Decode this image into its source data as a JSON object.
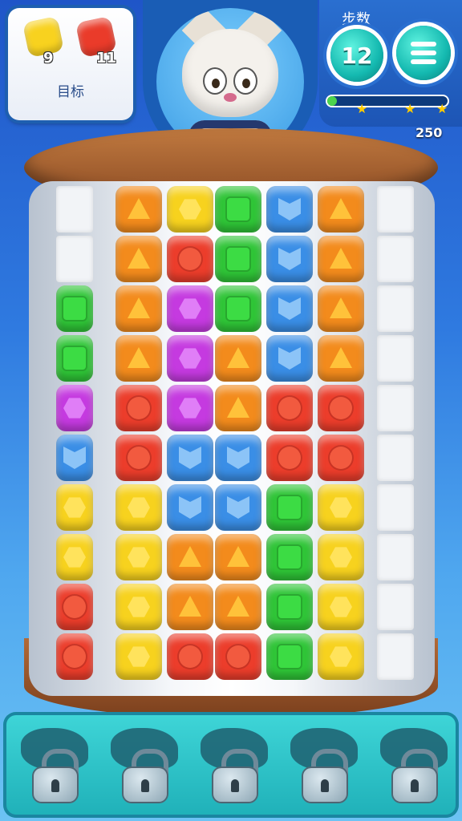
{
  "hud": {
    "goal": {
      "label": "目标",
      "items": [
        {
          "icon": "yellow-hexagon-cube-icon",
          "count": "9",
          "color": "#f8d21f"
        },
        {
          "icon": "red-circle-cube-icon",
          "count": "11",
          "color": "#ea3b2a"
        }
      ]
    },
    "moves_label": "步数",
    "moves_value": "12",
    "menu_icon": "menu-icon",
    "progress_fraction": 0.08,
    "stars": [
      "★",
      "★",
      "★"
    ],
    "score": "250"
  },
  "mascot": {
    "icon": "tiger-mascot-icon"
  },
  "colors": {
    "orange": "#f38b1c",
    "yellow": "#f7d21e",
    "green": "#2fc537",
    "blue": "#3a8ee6",
    "magenta": "#c53ae0",
    "red": "#ec3d2b",
    "white": "#f2f4f7"
  },
  "board": {
    "rows": [
      [
        "white",
        "orange",
        "yellow",
        "green",
        "blue",
        "orange",
        "white"
      ],
      [
        "white",
        "orange",
        "red",
        "green",
        "blue",
        "orange",
        "white"
      ],
      [
        "green",
        "orange",
        "magenta",
        "green",
        "blue",
        "orange",
        "white"
      ],
      [
        "green",
        "orange",
        "magenta",
        "orange",
        "blue",
        "orange",
        "white"
      ],
      [
        "magenta",
        "red",
        "magenta",
        "orange",
        "red",
        "red",
        "white"
      ],
      [
        "blue",
        "red",
        "blue",
        "blue",
        "red",
        "red",
        "white"
      ],
      [
        "yellow",
        "yellow",
        "blue",
        "blue",
        "green",
        "yellow",
        "white"
      ],
      [
        "yellow",
        "yellow",
        "orange",
        "orange",
        "green",
        "yellow",
        "white"
      ],
      [
        "red",
        "yellow",
        "orange",
        "orange",
        "green",
        "yellow",
        "white"
      ],
      [
        "red",
        "yellow",
        "red",
        "red",
        "green",
        "yellow",
        "white"
      ]
    ]
  },
  "collection": {
    "slots": [
      {
        "icon": "locked-padlock-icon"
      },
      {
        "icon": "locked-padlock-icon"
      },
      {
        "icon": "locked-padlock-icon"
      },
      {
        "icon": "locked-padlock-icon"
      },
      {
        "icon": "locked-padlock-icon"
      }
    ]
  }
}
